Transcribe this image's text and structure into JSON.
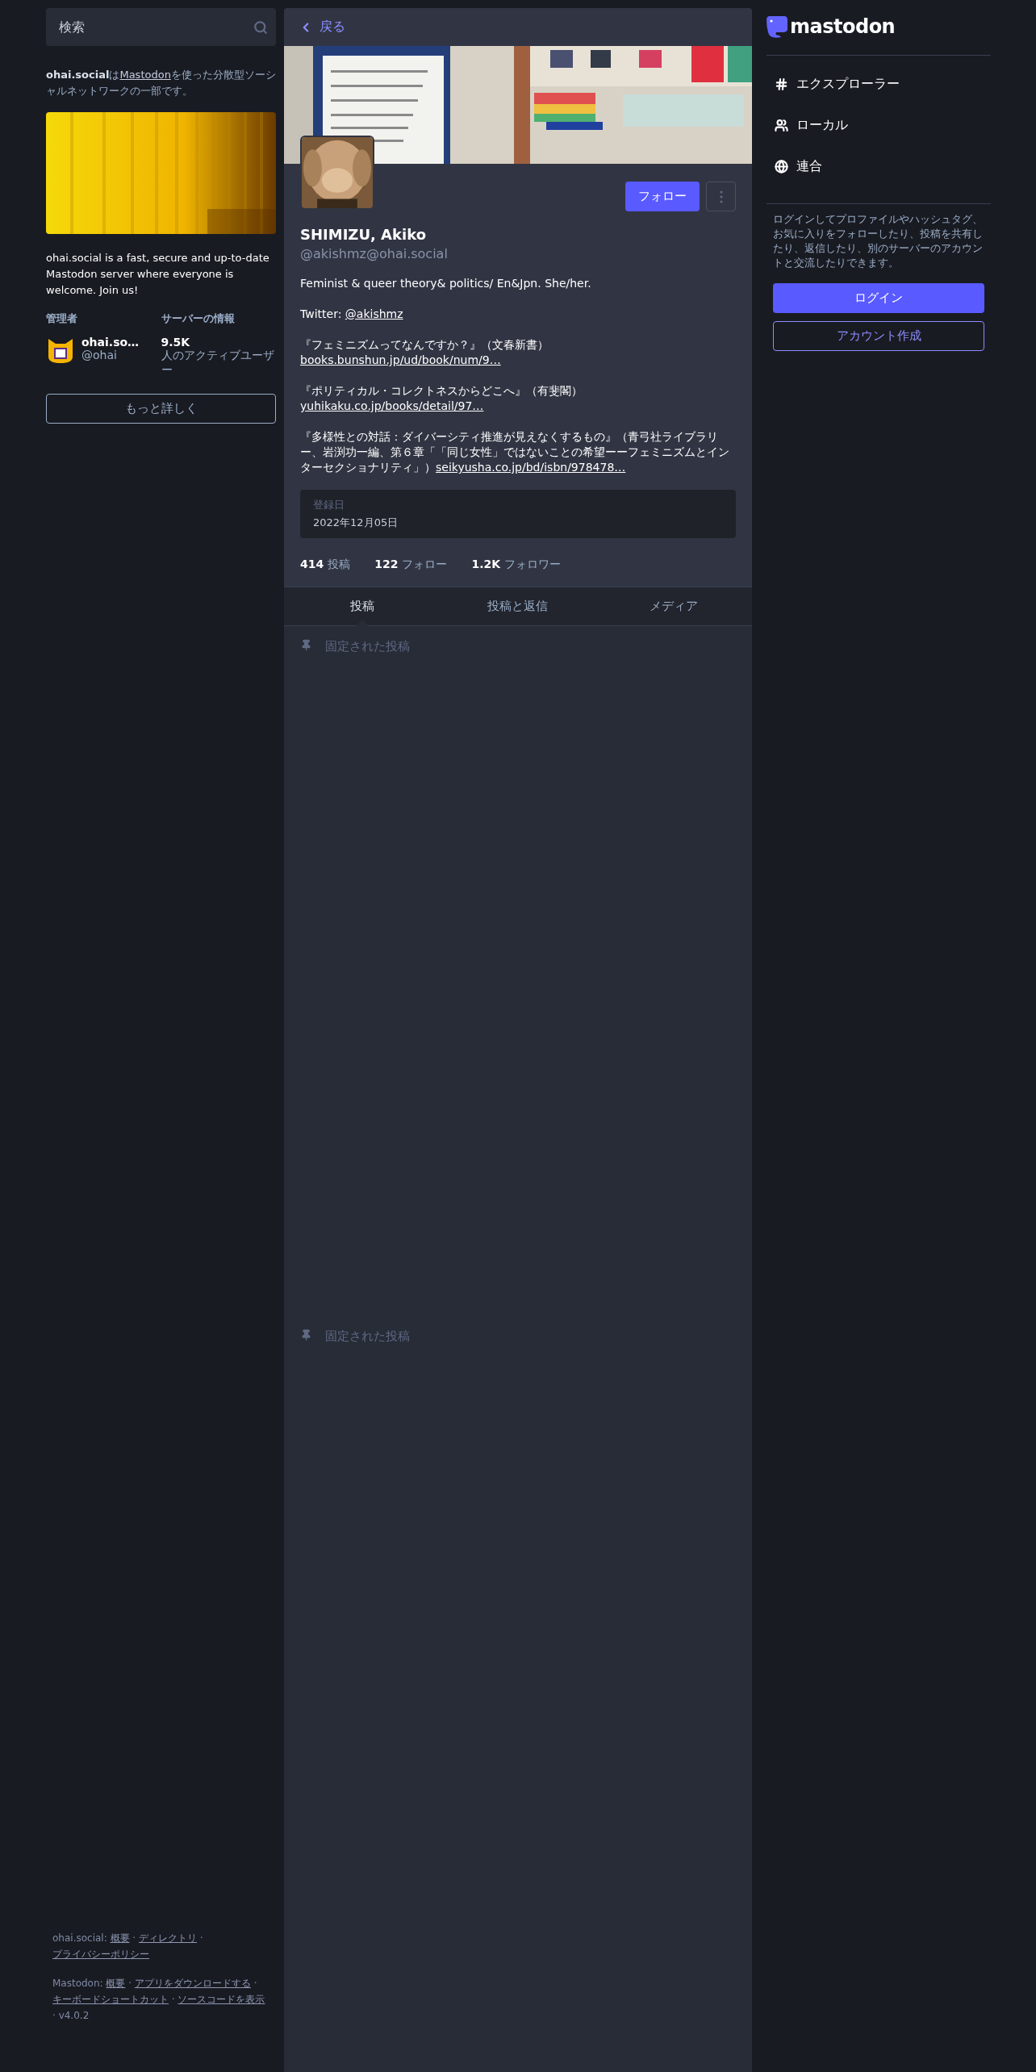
{
  "search": {
    "placeholder": "検索"
  },
  "server_intro": [
    {
      "kind": "bold",
      "text": "ohai.social"
    },
    {
      "kind": "text",
      "text": "は"
    },
    {
      "kind": "link",
      "text": "Mastodon"
    },
    {
      "kind": "text",
      "text": "を使った分散型ソーシャルネットワークの一部です。"
    }
  ],
  "server_description": "ohai.social is a fast, secure and up-to-date Mastodon server where everyone is welcome. Join us!",
  "admin": {
    "heading": "管理者",
    "name": "ohai.so…",
    "handle": "@ohai"
  },
  "server_info": {
    "heading": "サーバーの情報",
    "count": "9.5K",
    "label": "人のアクティブユーザー"
  },
  "more_button": "もっと詳しく",
  "footer": [
    {
      "label": "ohai.social:",
      "separator": "·",
      "links": [
        "概要",
        "ディレクトリ",
        "プライバシーポリシー"
      ]
    },
    {
      "label": "Mastodon:",
      "separator": "·",
      "links": [
        "概要",
        "アプリをダウンロードする",
        "キーボードショートカット",
        "ソースコードを表示"
      ],
      "version": "v4.0.2"
    }
  ],
  "back_button": "戻る",
  "profile": {
    "name": "SHIMIZU, Akiko",
    "handle": "@akishmz@ohai.social",
    "follow_button": "フォロー",
    "bio": [
      [
        {
          "kind": "text",
          "text": "Feminist & queer theory& politics/ En&Jpn. She/her."
        }
      ],
      [
        {
          "kind": "text",
          "text": "Twitter: "
        },
        {
          "kind": "link",
          "text": "@akishmz"
        }
      ],
      [
        {
          "kind": "text",
          "text": "『フェミニズムってなんですか？』（文春新書）"
        },
        {
          "kind": "link",
          "text": "books.bunshun.jp/ud/book/num/9…"
        }
      ],
      [
        {
          "kind": "text",
          "text": "『ポリティカル・コレクトネスからどこへ』（有斐閣）"
        },
        {
          "kind": "link",
          "text": "yuhikaku.co.jp/books/detail/97…"
        }
      ],
      [
        {
          "kind": "text",
          "text": "『多様性との対話：ダイバーシティ推進が見えなくするもの』（青弓社ライブラリー、岩渕功一編、第６章「「同じ女性」ではないことの希望ーーフェミニズムとインターセクショナリティ」）"
        },
        {
          "kind": "link",
          "text": "seikyusha.co.jp/bd/isbn/978478…"
        }
      ]
    ],
    "joined": {
      "label": "登録日",
      "date": "2022年12月05日"
    },
    "stats": [
      {
        "value": "414",
        "label": "投稿"
      },
      {
        "value": "122",
        "label": "フォロー"
      },
      {
        "value": "1.2K",
        "label": "フォロワー"
      }
    ]
  },
  "tabs": [
    {
      "label": "投稿",
      "selected": true
    },
    {
      "label": "投稿と返信",
      "selected": false
    },
    {
      "label": "メディア",
      "selected": false
    }
  ],
  "pinned_sections": [
    {
      "label": "固定された投稿"
    },
    {
      "label": "固定された投稿"
    }
  ],
  "logo": "mastodon",
  "nav": [
    {
      "label": "エクスプローラー"
    },
    {
      "label": "ローカル"
    },
    {
      "label": "連合"
    }
  ],
  "login_prompt": "ログインしてプロファイルやハッシュタグ、お気に入りをフォローしたり、投稿を共有したり、返信したり、別のサーバーのアカウントと交流したりできます。",
  "login_button": "ログイン",
  "signup_button": "アカウント作成"
}
